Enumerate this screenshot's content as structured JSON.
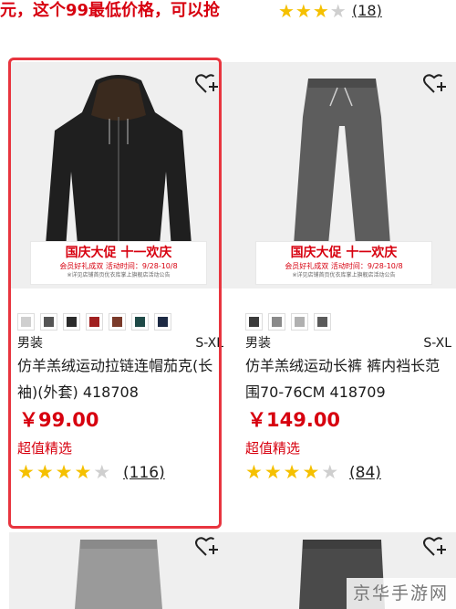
{
  "top_strip": {
    "promo_text": "元，这个99最低价格，可以抢",
    "stars": "★★★",
    "stars_empty": "★",
    "review_count": "(18)"
  },
  "products": [
    {
      "banner_title": "国庆大促 十一欢庆",
      "banner_sub": "会员好礼成双 活动时间：9/28-10/8",
      "banner_note": "※详见店铺首页优衣库掌上旗舰店活动公告",
      "swatch_colors": [
        "#cfcfcf",
        "#555555",
        "#2b2b2b",
        "#a02020",
        "#7a3a2a",
        "#1f4a48",
        "#1d2a44"
      ],
      "gender": "男装",
      "size_range": "S-XL",
      "name": "仿羊羔绒运动拉链连帽茄克(长袖)(外套) 418708",
      "price": "￥99.00",
      "tag": "超值精选",
      "stars_filled": "★★★★",
      "stars_empty": "★",
      "review_count": "(116)",
      "rating": 4
    },
    {
      "banner_title": "国庆大促 十一欢庆",
      "banner_sub": "会员好礼成双 活动时间：9/28-10/8",
      "banner_note": "※详见店铺首页优衣库掌上旗舰店活动公告",
      "swatch_colors": [
        "#3b3b3b",
        "#8a8a8a",
        "#b0b0b0",
        "#5a5a5a"
      ],
      "gender": "男装",
      "size_range": "S-XL",
      "name": "仿羊羔绒运动长裤 裤内裆长范围70-76CM 418709",
      "price": "￥149.00",
      "tag": "超值精选",
      "stars_filled": "★★★★",
      "stars_empty": "★",
      "review_count": "(84)",
      "rating": 4
    }
  ],
  "watermark": "京华手游网",
  "colors": {
    "accent_red": "#d7000f",
    "star_gold": "#f5c000",
    "highlight_border": "#e8353f"
  }
}
